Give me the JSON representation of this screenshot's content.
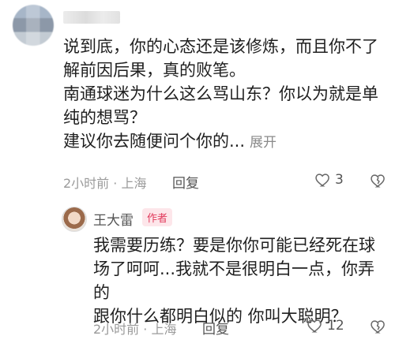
{
  "comment1": {
    "lines": [
      "说到底，你的心态还是该修炼，而且你不了",
      "解前因后果，真的败笔。",
      "南通球迷为什么这么骂山东？你以为就是单",
      "纯的想骂？",
      "建议你去随便问个你的..."
    ],
    "expand_label": "展开",
    "time": "2小时前",
    "location": "上海",
    "reply_label": "回复",
    "likes": "3"
  },
  "comment2": {
    "author": "王大雷",
    "badge": "作者",
    "lines": [
      "我需要历练？要是你你可能已经死在球",
      "场了呵呵...我就不是很明白一点，你弄的",
      "跟你什么都明白似的 你叫大聪明？"
    ],
    "time": "2小时前",
    "location": "上海",
    "reply_label": "回复",
    "likes": "12"
  }
}
